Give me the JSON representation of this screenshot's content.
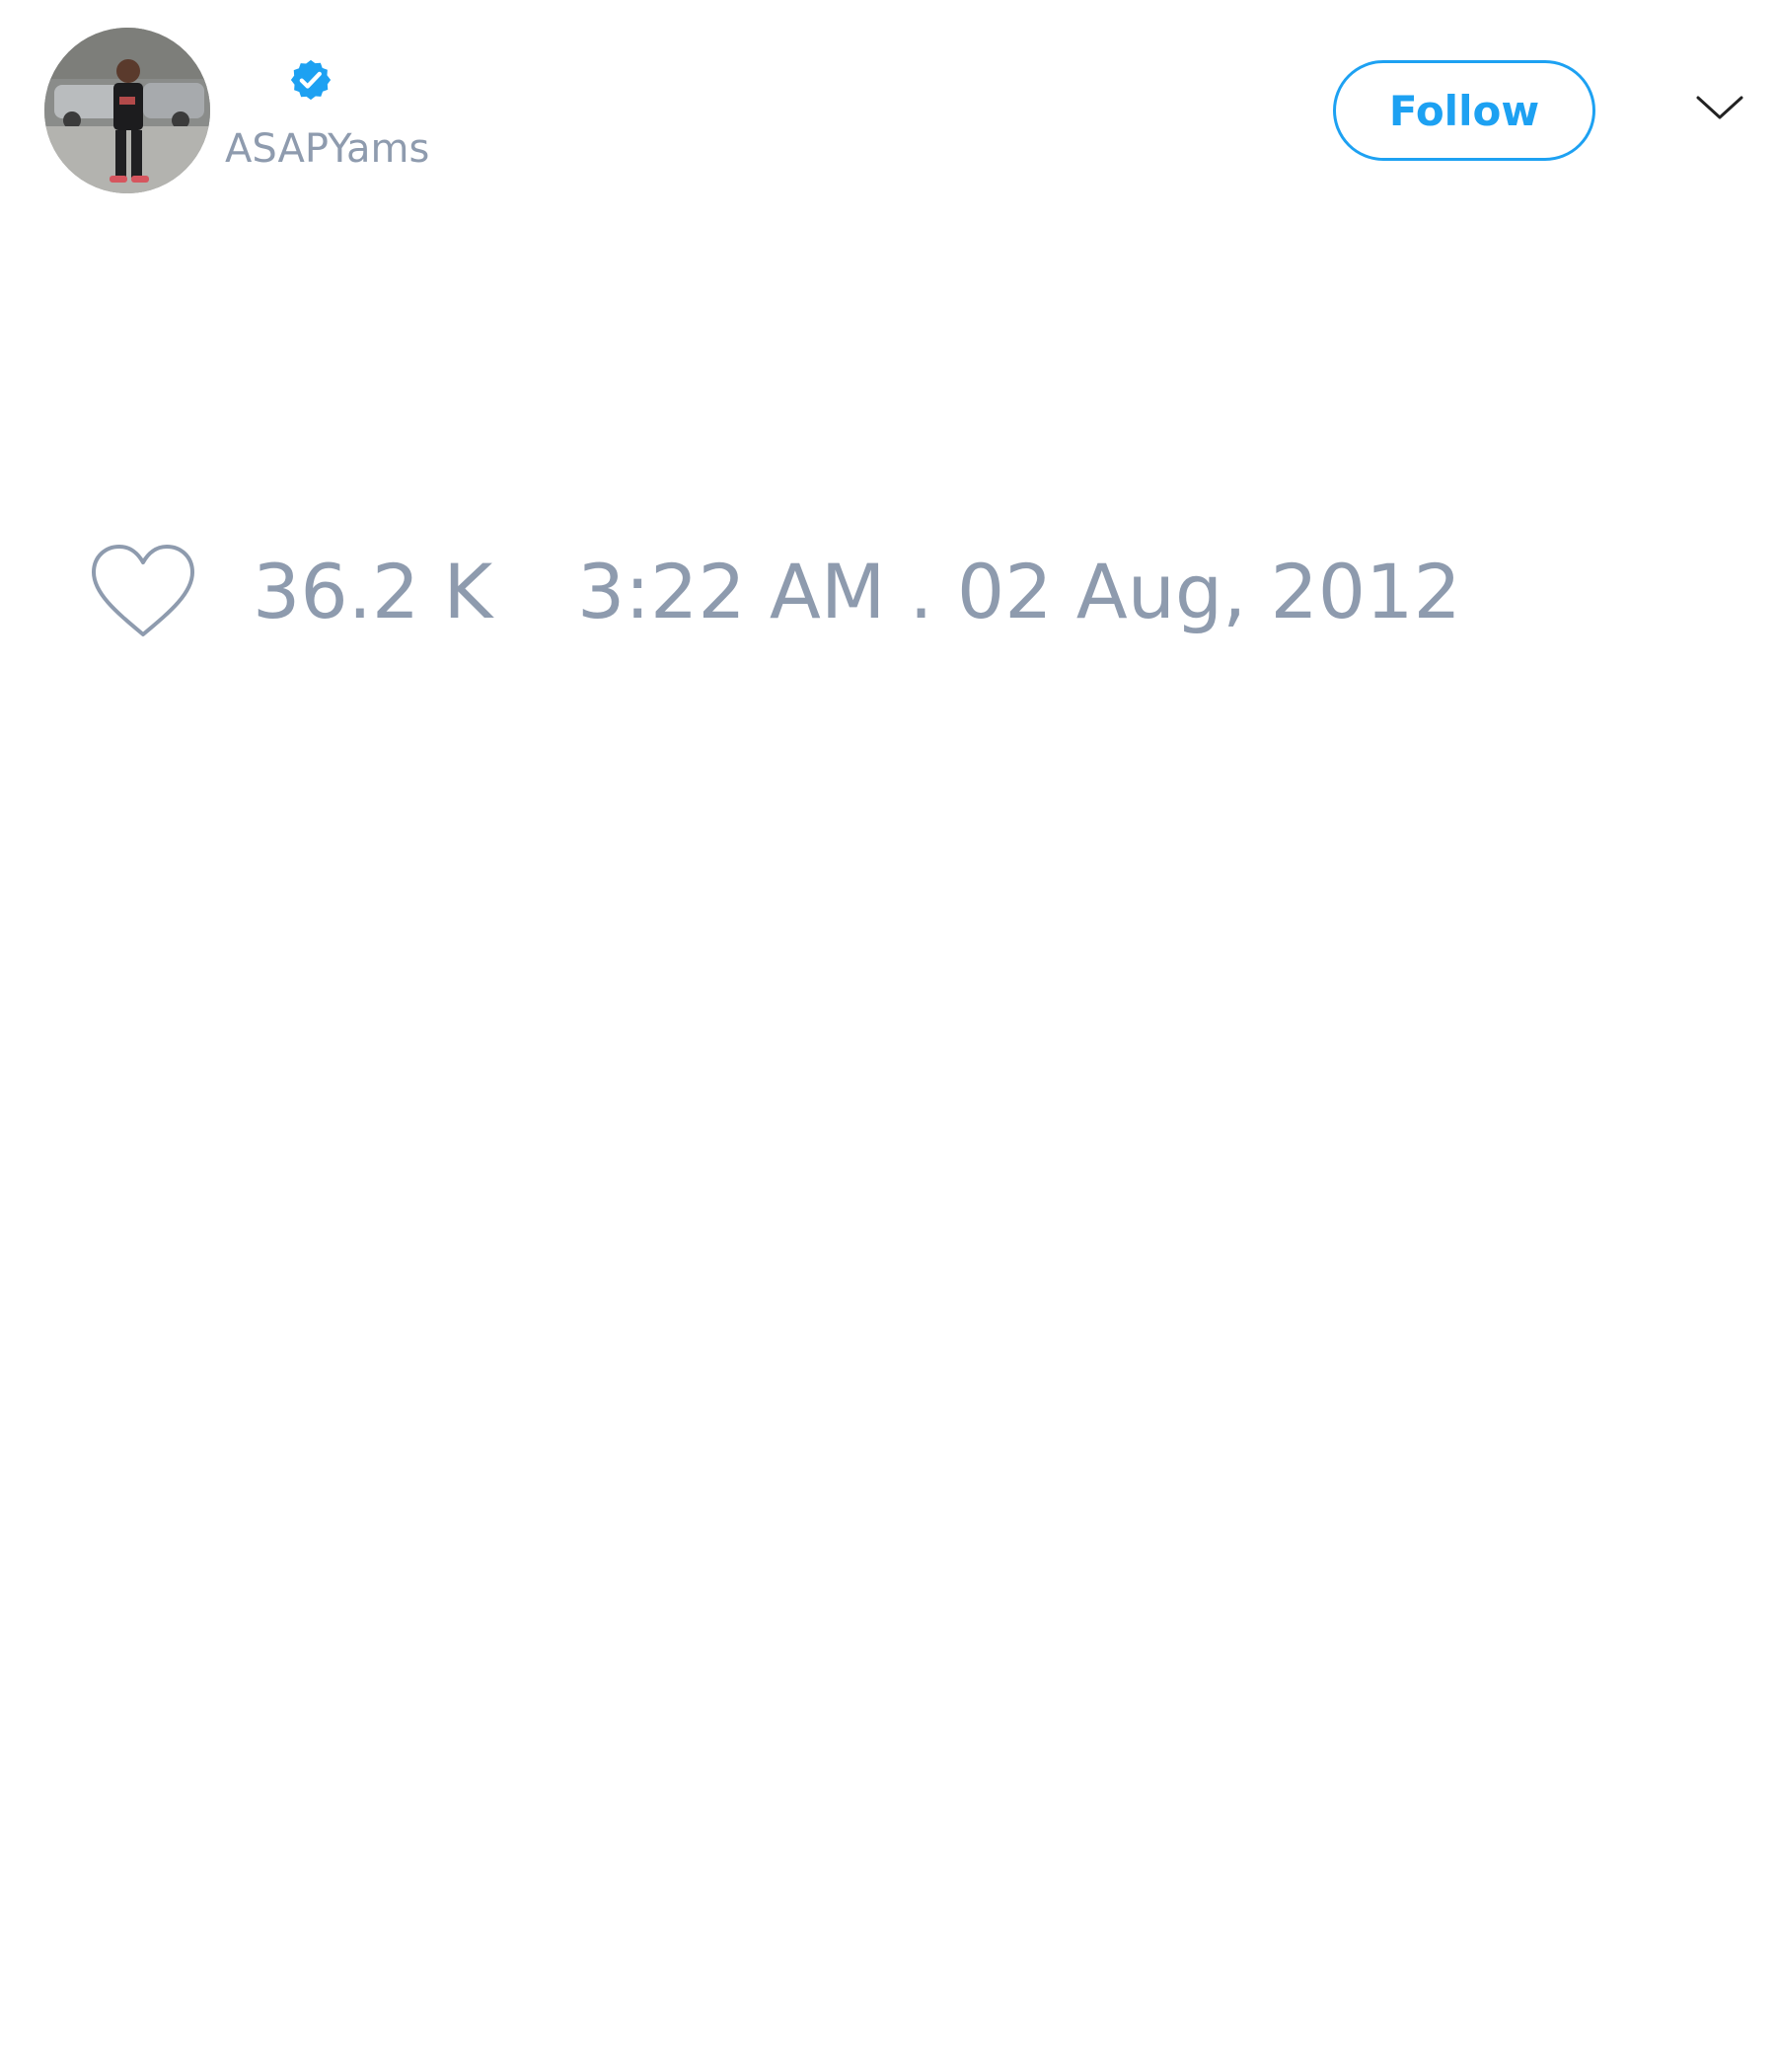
{
  "user": {
    "username": "ASAPYams",
    "verified": true,
    "avatar": "profile-photo"
  },
  "actions": {
    "follow_label": "Follow",
    "menu_icon": "chevron-down-icon"
  },
  "stats": {
    "like_icon": "heart-outline-icon",
    "like_count": "36.2 K",
    "timestamp": "3:22 AM . 02 Aug, 2012"
  },
  "colors": {
    "accent": "#1da1f2",
    "muted_text": "#8e9bae",
    "background": "#ffffff"
  }
}
